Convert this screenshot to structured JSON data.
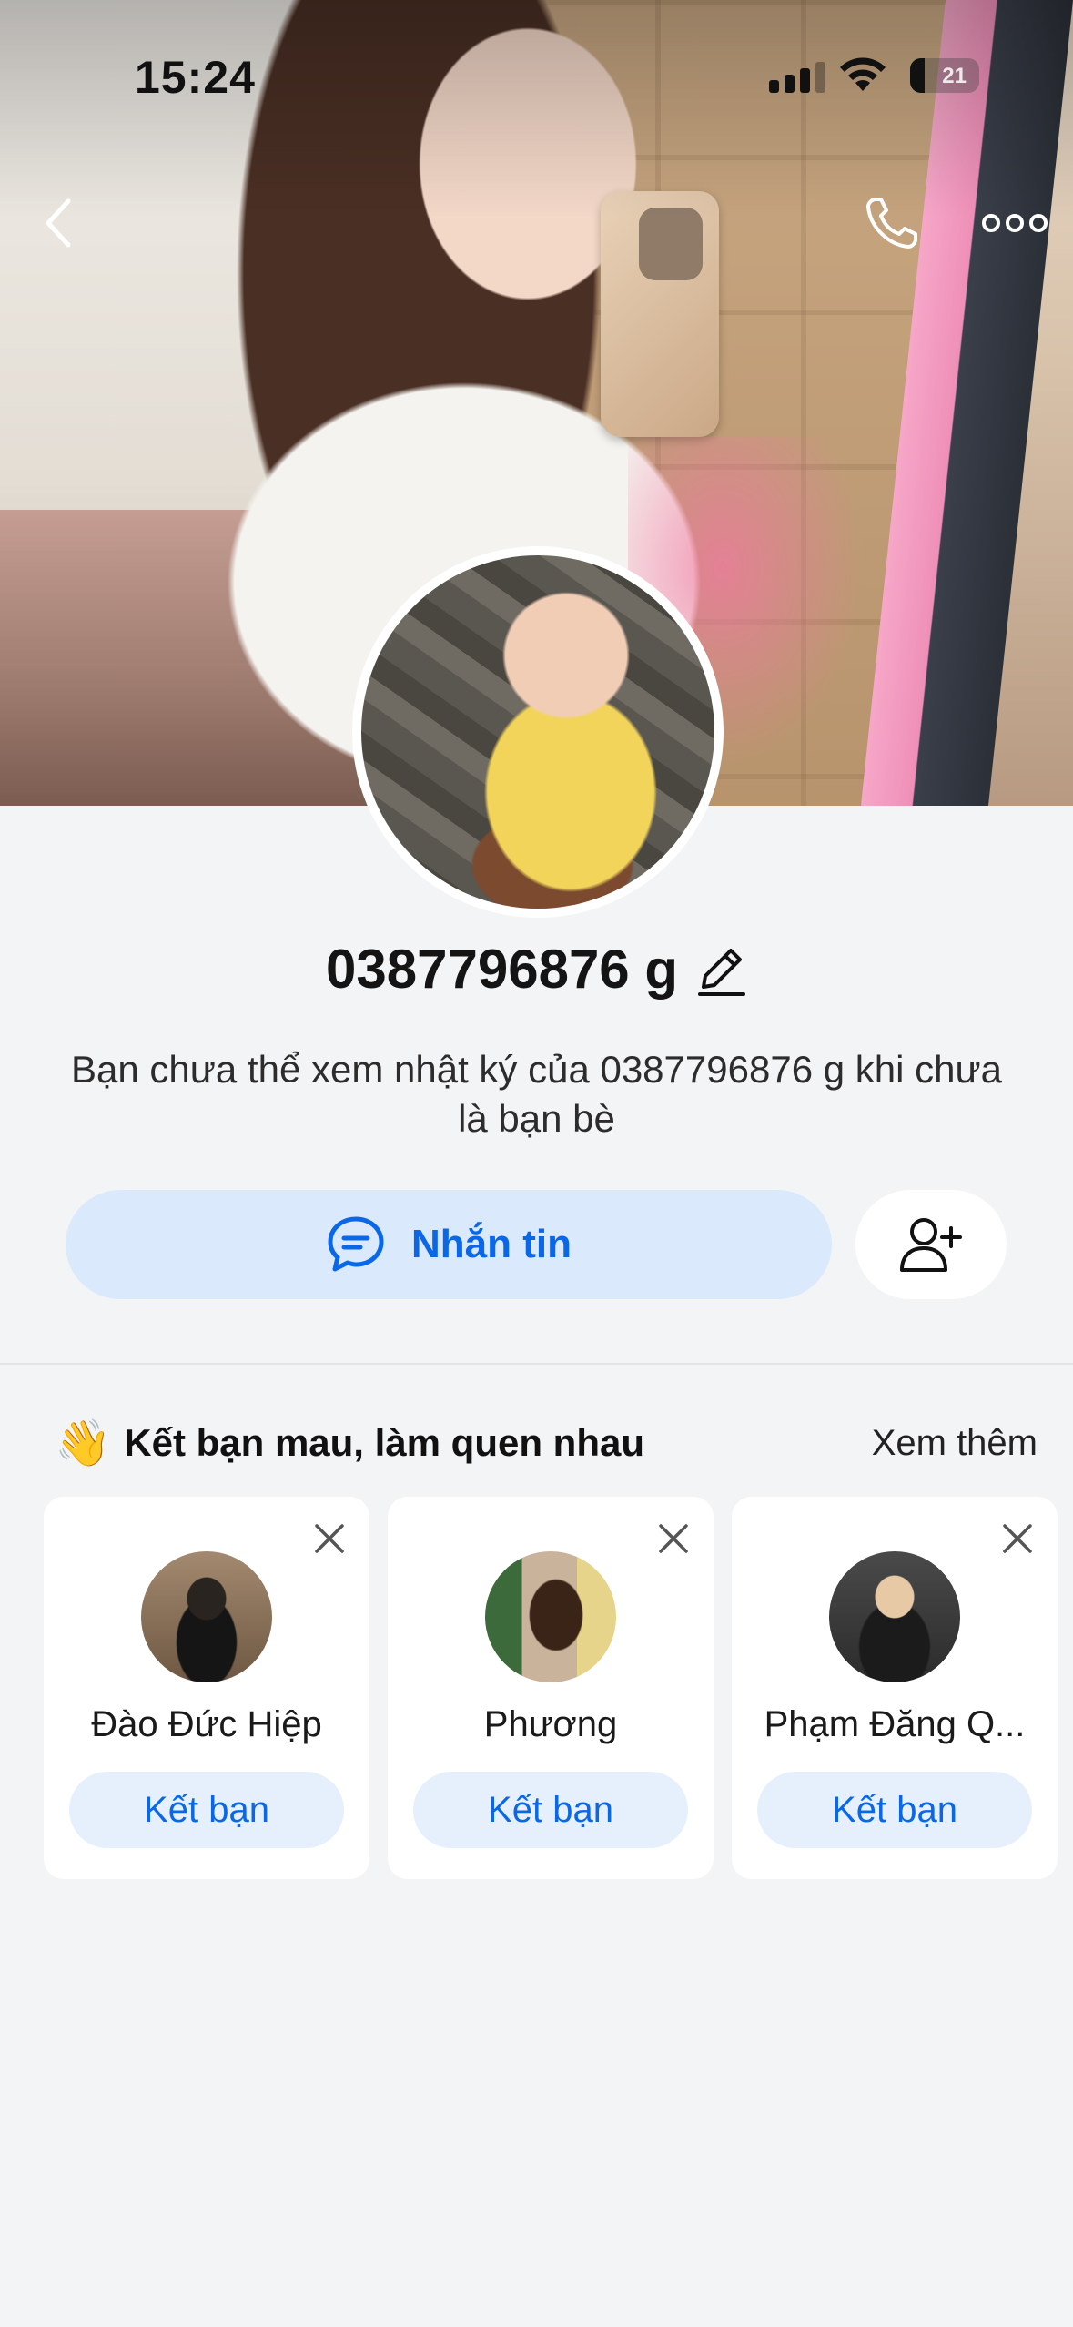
{
  "status_bar": {
    "time": "15:24",
    "battery_level": "21",
    "battery_fraction": 0.21
  },
  "profile": {
    "name": "0387796876 g",
    "description": "Bạn chưa thể xem nhật ký của 0387796876 g khi chưa là bạn bè",
    "message_button_label": "Nhắn tin"
  },
  "icons": {
    "back": "chevron-left-icon",
    "call": "phone-icon",
    "more": "more-horizontal-icon",
    "edit": "pencil-icon",
    "message": "chat-bubble-icon",
    "add_friend": "user-plus-icon",
    "wave": "waving-hand-icon",
    "close": "close-icon"
  },
  "suggestions": {
    "title_emoji": "👋",
    "title": "Kết bạn mau, làm quen nhau",
    "see_more": "Xem thêm",
    "items": [
      {
        "name": "Đào Đức Hiệp",
        "button": "Kết bạn"
      },
      {
        "name": "Phương",
        "button": "Kết bạn"
      },
      {
        "name": "Phạm Đăng Q...",
        "button": "Kết bạn"
      }
    ]
  },
  "colors": {
    "accent": "#0a68e8",
    "accent_soft": "#dbe9fc",
    "background": "#f3f4f6"
  }
}
